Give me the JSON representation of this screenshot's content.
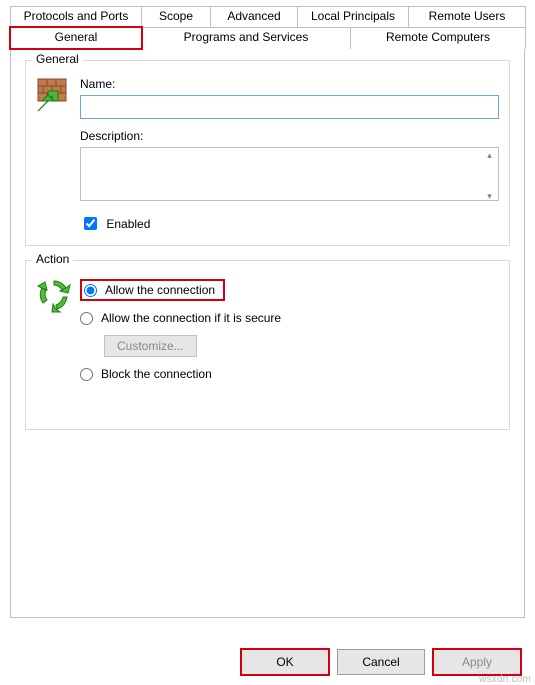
{
  "tabs": {
    "row1": [
      "Protocols and Ports",
      "Scope",
      "Advanced",
      "Local Principals",
      "Remote Users"
    ],
    "row2": [
      "General",
      "Programs and Services",
      "Remote Computers"
    ],
    "active": "General"
  },
  "general_group": {
    "legend": "General",
    "name_label": "Name:",
    "name_value": "",
    "desc_label": "Description:",
    "desc_value": "",
    "enabled_label": "Enabled",
    "enabled_checked": true
  },
  "action_group": {
    "legend": "Action",
    "allow": "Allow the connection",
    "allow_secure": "Allow the connection if it is secure",
    "customize": "Customize...",
    "block": "Block the connection",
    "selected": "allow"
  },
  "buttons": {
    "ok": "OK",
    "cancel": "Cancel",
    "apply": "Apply"
  },
  "watermark": "wsxdn.com"
}
